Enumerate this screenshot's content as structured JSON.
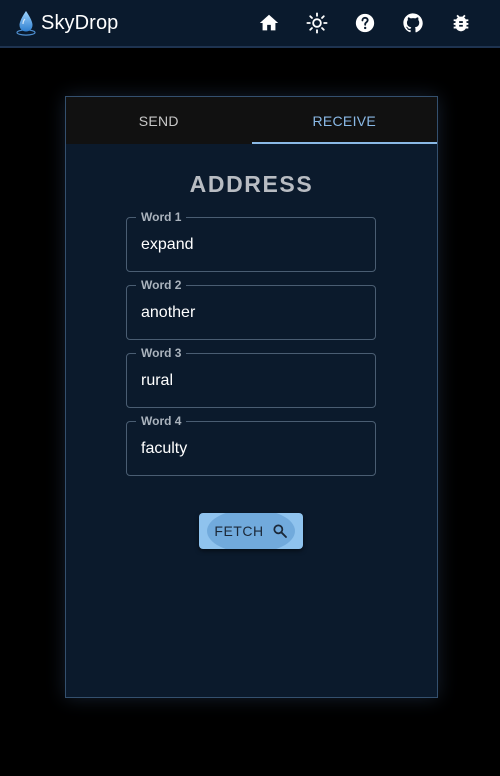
{
  "app": {
    "brand_name": "SkyDrop",
    "brand_icon": "water-drop-icon"
  },
  "nav": {
    "icons": [
      "home-icon",
      "brightness-icon",
      "help-icon",
      "github-icon",
      "bug-icon"
    ]
  },
  "tabs": [
    {
      "label": "SEND",
      "active": false
    },
    {
      "label": "RECEIVE",
      "active": true
    }
  ],
  "receive": {
    "title": "ADDRESS",
    "fields": [
      {
        "label": "Word 1",
        "value": "expand"
      },
      {
        "label": "Word 2",
        "value": "another"
      },
      {
        "label": "Word 3",
        "value": "rural"
      },
      {
        "label": "Word 4",
        "value": "faculty"
      }
    ],
    "fetch_label": "FETCH",
    "fetch_icon": "search-icon"
  },
  "colors": {
    "accent": "#8ab9e6",
    "button": "#8fc3ee",
    "card_bg": "#0b1a2c",
    "appbar_bg": "#0a1a2d"
  }
}
